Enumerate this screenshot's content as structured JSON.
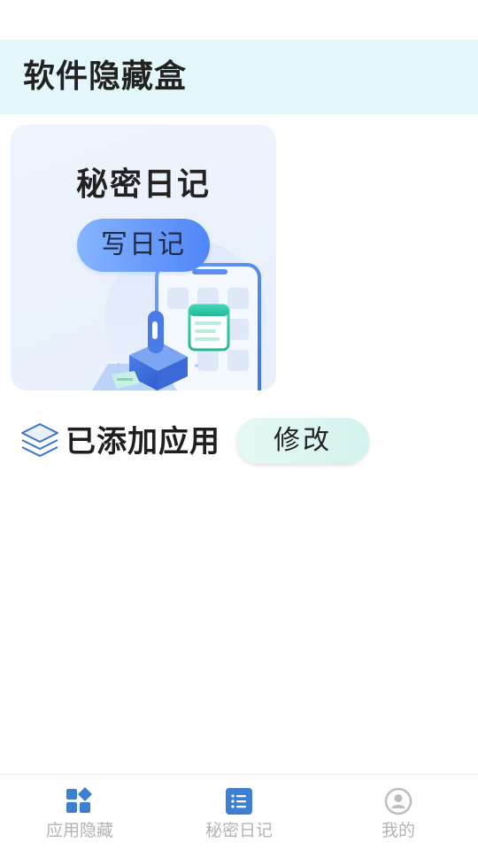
{
  "header": {
    "title": "软件隐藏盒"
  },
  "diary_card": {
    "title": "秘密日记",
    "button_label": "写日记"
  },
  "added_apps": {
    "title": "已添加应用",
    "edit_label": "修改"
  },
  "bottom_nav": {
    "items": [
      {
        "label": "应用隐藏",
        "icon": "grid-diamond-icon",
        "active": true
      },
      {
        "label": "秘密日记",
        "icon": "list-icon",
        "active": false
      },
      {
        "label": "我的",
        "icon": "user-circle-icon",
        "active": false
      }
    ]
  },
  "colors": {
    "header_bg": "#e4f8fc",
    "accent_blue": "#3d7fd0",
    "button_gradient_start": "#86b4ff",
    "button_gradient_end": "#4f86f7",
    "edit_button_bg": "#d4f3ee",
    "nav_label_gray": "#b3b3b3"
  }
}
